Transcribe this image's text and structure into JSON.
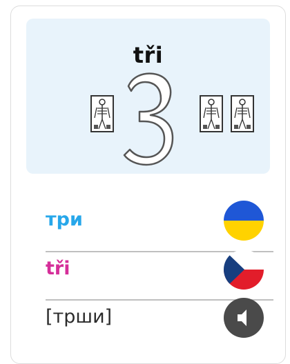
{
  "card": {
    "title": "tři"
  },
  "rows": {
    "ukrainian": {
      "text": "три",
      "icon": "flag-ukraine-icon",
      "color": "#27a7ea"
    },
    "czech": {
      "text": "tři",
      "icon": "flag-czech-icon",
      "color": "#d52e99"
    },
    "pronunciation": {
      "text": "[трши]",
      "icon": "speaker-icon",
      "color": "#2b2b2b"
    }
  },
  "colors": {
    "panel_bg": "#e8f3fb",
    "ukraine_blue": "#1f57d6",
    "ukraine_yellow": "#ffd200",
    "czech_blue": "#173e7f",
    "czech_red": "#e21d2a",
    "speaker_bg": "#4a4a4a"
  }
}
